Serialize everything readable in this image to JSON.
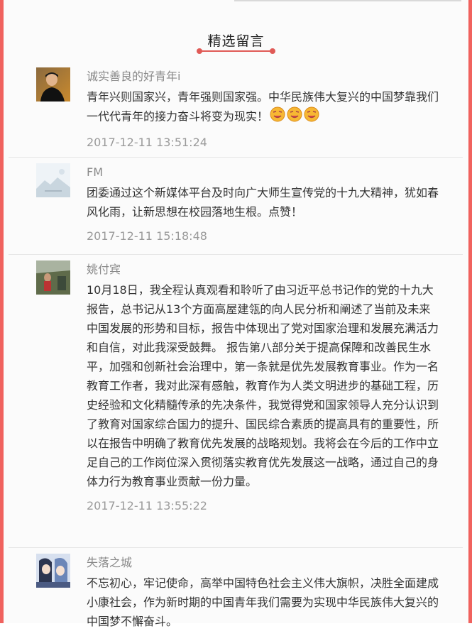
{
  "section": {
    "title": "精选留言"
  },
  "comments": [
    {
      "nickname": "诚实善良的好青年i",
      "text": "青年兴则国家兴，青年强则国家强。中华民族伟大复兴的中国梦靠我们一代代青年的接力奋斗将变为现实！",
      "emoji_count": 3,
      "emoji_icon": "smiling-face-icon",
      "time": "2017-12-11 13:51:24",
      "avatar_icon": "person-portrait-avatar"
    },
    {
      "nickname": "FM",
      "text": "团委通过这个新媒体平台及时向广大师生宣传党的十九大精神，犹如春风化雨，让新思想在校园落地生根。点赞！",
      "time": "2017-12-11 15:18:48",
      "avatar_icon": "landscape-placeholder-avatar"
    },
    {
      "nickname": "姚付宾",
      "text": "10月18日，我全程认真观看和聆听了由习近平总书记作的党的十九大报告，总书记从13个方面高屋建瓴的向人民分析和阐述了当前及未来中国发展的形势和目标，报告中体现出了党对国家治理和发展充满活力和自信，对此我深受鼓舞。 报告第八部分关于提高保障和改善民生水平，加强和创新社会治理中，第一条就是优先发展教育事业。作为一名教育工作者，我对此深有感触，教育作为人类文明进步的基础工程，历史经验和文化精髓传承的先决条件，我觉得党和国家领导人充分认识到了教育对国家综合国力的提升、国民综合素质的提高具有的重要性，所以在报告中明确了教育优先发展的战略规划。我将会在今后的工作中立足自己的工作岗位深入贯彻落实教育优先发展这一战略，通过自己的身体力行为教育事业贡献一份力量。",
      "time": "2017-12-11 13:55:22",
      "avatar_icon": "outdoor-photo-avatar"
    },
    {
      "nickname": "失落之城",
      "text": "不忘初心，牢记使命，高举中国特色社会主义伟大旗帜，决胜全面建成小康社会，作为新时期的中国青年我们需要为实现中华民族伟大复兴的中国梦不懈奋斗。",
      "time": "",
      "avatar_icon": "anime-illustration-avatar"
    }
  ],
  "colors": {
    "border_accent": "#f0625e",
    "header_line": "#e05a56",
    "nickname": "#8a8a8a",
    "body_text": "#333333",
    "timestamp": "#9a9a9a"
  }
}
